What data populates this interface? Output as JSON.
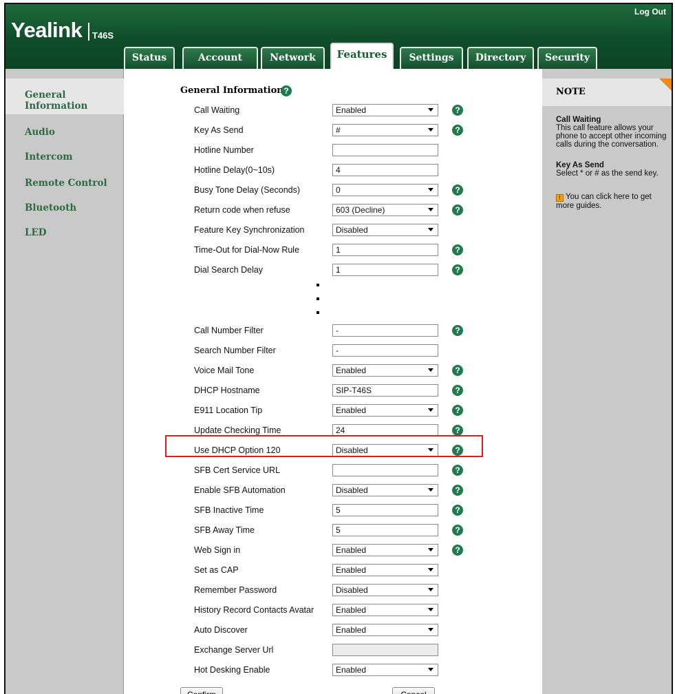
{
  "header": {
    "logout_label": "Log Out",
    "logo_text": "Yealink",
    "model": "T46S",
    "tabs": [
      {
        "label": "Status"
      },
      {
        "label": "Account"
      },
      {
        "label": "Network"
      },
      {
        "label": "Features",
        "active": true
      },
      {
        "label": "Settings"
      },
      {
        "label": "Directory"
      },
      {
        "label": "Security"
      }
    ]
  },
  "sidebar": {
    "items": [
      {
        "label": "General Information",
        "active": true
      },
      {
        "label": "Audio"
      },
      {
        "label": "Intercom"
      },
      {
        "label": "Remote Control"
      },
      {
        "label": "Bluetooth"
      },
      {
        "label": "LED"
      }
    ]
  },
  "main": {
    "section_title": "General Information",
    "help_symbol": "?",
    "rows_top": [
      {
        "label": "Call Waiting",
        "type": "select",
        "value": "Enabled"
      },
      {
        "label": "Key As Send",
        "type": "select",
        "value": "#"
      },
      {
        "label": "Hotline Number",
        "type": "text",
        "value": ""
      },
      {
        "label": "Hotline Delay(0~10s)",
        "type": "text",
        "value": "4"
      },
      {
        "label": "Busy Tone Delay (Seconds)",
        "type": "select",
        "value": "0"
      },
      {
        "label": "Return code when refuse",
        "type": "select",
        "value": "603 (Decline)"
      },
      {
        "label": "Feature Key Synchronization",
        "type": "select",
        "value": "Disabled"
      },
      {
        "label": "Time-Out for Dial-Now Rule",
        "type": "text",
        "value": "1"
      },
      {
        "label": "Dial Search Delay",
        "type": "text",
        "value": "1"
      }
    ],
    "rows_bottom": [
      {
        "label": "Call Number Filter",
        "type": "text",
        "value": "-"
      },
      {
        "label": "Search Number Filter",
        "type": "text",
        "value": "-"
      },
      {
        "label": "Voice Mail Tone",
        "type": "select",
        "value": "Enabled"
      },
      {
        "label": "DHCP Hostname",
        "type": "text",
        "value": "SIP-T46S"
      },
      {
        "label": "E911 Location Tip",
        "type": "select",
        "value": "Enabled"
      },
      {
        "label": "Update Checking Time",
        "type": "text",
        "value": "24"
      },
      {
        "label": "Use DHCP Option 120",
        "type": "select",
        "value": "Disabled"
      },
      {
        "label": "SFB Cert Service URL",
        "type": "text",
        "value": ""
      },
      {
        "label": "Enable SFB Automation",
        "type": "select",
        "value": "Disabled"
      },
      {
        "label": "SFB Inactive Time",
        "type": "text",
        "value": "5"
      },
      {
        "label": "SFB Away Time",
        "type": "text",
        "value": "5"
      },
      {
        "label": "Web Sign in",
        "type": "select",
        "value": "Enabled"
      },
      {
        "label": "Set as CAP",
        "type": "select",
        "value": "Enabled"
      },
      {
        "label": "Remember Password",
        "type": "select",
        "value": "Disabled"
      },
      {
        "label": "History Record Contacts Avatar",
        "type": "select",
        "value": "Enabled"
      },
      {
        "label": "Auto Discover",
        "type": "select",
        "value": "Enabled"
      },
      {
        "label": "Exchange Server Url",
        "type": "text",
        "value": ""
      },
      {
        "label": "Hot Desking Enable",
        "type": "select",
        "value": "Enabled"
      }
    ],
    "confirm_label": "Confirm",
    "cancel_label": "Cancel"
  },
  "note": {
    "title": "NOTE",
    "call_waiting_title": "Call Waiting",
    "call_waiting_text": "This call feature allows your phone to accept other incoming calls during the conversation.",
    "key_as_send_title": "Key As Send",
    "key_as_send_text": "Select * or # as the send key.",
    "guide_text": "You can click here to get more guides."
  },
  "colors": {
    "header_green": "#0f4d2a",
    "sidebar_link": "#2d6a44",
    "help_icon": "#1f7a4e",
    "highlight_box": "#e01b1b",
    "note_corner": "#f08a1c",
    "panel_gray": "#c9c9c9"
  }
}
